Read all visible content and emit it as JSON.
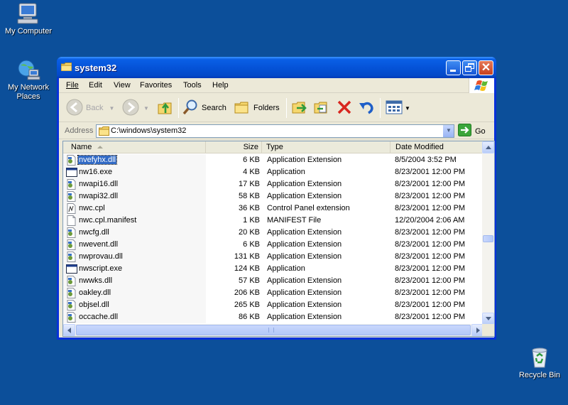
{
  "desktop": {
    "icons": [
      {
        "label": "My Computer"
      },
      {
        "label": "My Network Places"
      },
      {
        "label": "Recycle Bin"
      }
    ]
  },
  "window": {
    "title": "system32",
    "menu": [
      "File",
      "Edit",
      "View",
      "Favorites",
      "Tools",
      "Help"
    ],
    "toolbar": {
      "back": "Back",
      "search": "Search",
      "folders": "Folders"
    },
    "address": {
      "label": "Address",
      "value": "C:\\windows\\system32",
      "go": "Go"
    },
    "columns": [
      "Name",
      "Size",
      "Type",
      "Date Modified"
    ],
    "sort_column": "Name",
    "files": [
      {
        "name": "nvefyhx.dll",
        "size": "6 KB",
        "type": "Application Extension",
        "date": "8/5/2004 3:52 PM",
        "icon": "dll-icon",
        "selected": true
      },
      {
        "name": "nw16.exe",
        "size": "4 KB",
        "type": "Application",
        "date": "8/23/2001 12:00 PM",
        "icon": "exe-icon"
      },
      {
        "name": "nwapi16.dll",
        "size": "17 KB",
        "type": "Application Extension",
        "date": "8/23/2001 12:00 PM",
        "icon": "dll-icon"
      },
      {
        "name": "nwapi32.dll",
        "size": "58 KB",
        "type": "Application Extension",
        "date": "8/23/2001 12:00 PM",
        "icon": "dll-icon"
      },
      {
        "name": "nwc.cpl",
        "size": "36 KB",
        "type": "Control Panel extension",
        "date": "8/23/2001 12:00 PM",
        "icon": "cpl-icon"
      },
      {
        "name": "nwc.cpl.manifest",
        "size": "1 KB",
        "type": "MANIFEST File",
        "date": "12/20/2004 2:06 AM",
        "icon": "file-icon"
      },
      {
        "name": "nwcfg.dll",
        "size": "20 KB",
        "type": "Application Extension",
        "date": "8/23/2001 12:00 PM",
        "icon": "dll-icon"
      },
      {
        "name": "nwevent.dll",
        "size": "6 KB",
        "type": "Application Extension",
        "date": "8/23/2001 12:00 PM",
        "icon": "dll-icon"
      },
      {
        "name": "nwprovau.dll",
        "size": "131 KB",
        "type": "Application Extension",
        "date": "8/23/2001 12:00 PM",
        "icon": "dll-icon"
      },
      {
        "name": "nwscript.exe",
        "size": "124 KB",
        "type": "Application",
        "date": "8/23/2001 12:00 PM",
        "icon": "exe-icon"
      },
      {
        "name": "nwwks.dll",
        "size": "57 KB",
        "type": "Application Extension",
        "date": "8/23/2001 12:00 PM",
        "icon": "dll-icon"
      },
      {
        "name": "oakley.dll",
        "size": "206 KB",
        "type": "Application Extension",
        "date": "8/23/2001 12:00 PM",
        "icon": "dll-icon"
      },
      {
        "name": "objsel.dll",
        "size": "265 KB",
        "type": "Application Extension",
        "date": "8/23/2001 12:00 PM",
        "icon": "dll-icon"
      },
      {
        "name": "occache.dll",
        "size": "86 KB",
        "type": "Application Extension",
        "date": "8/23/2001 12:00 PM",
        "icon": "dll-icon"
      }
    ]
  },
  "colors": {
    "desktop": "#0c4f9a",
    "titlebar": "#0553d8",
    "selection": "#316ac5",
    "window_face": "#ece9d8"
  }
}
